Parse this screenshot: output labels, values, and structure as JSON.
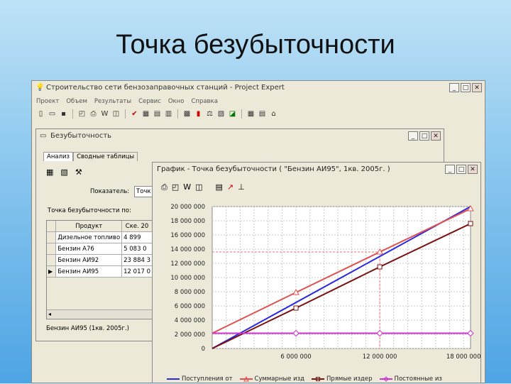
{
  "slide": {
    "title": "Точка безубыточности"
  },
  "main_window": {
    "title": "Строительство сети бензозаправочных станций - Project Expert",
    "menu": [
      "Проект",
      "Объем",
      "Результаты",
      "Сервис",
      "Окно",
      "Справка"
    ]
  },
  "be_window": {
    "title": "Безубыточность",
    "tabs": [
      "Анализ",
      "Сводные таблицы"
    ],
    "indicator_label": "Показатель:",
    "indicator_value": "Точк",
    "breakeven_label": "Точка безубыточности по:",
    "table": {
      "headers": [
        "Продукт",
        "Ске. 20"
      ],
      "rows": [
        [
          "Дизельное топливо",
          "4 899"
        ],
        [
          "Бензин А76",
          "5 083 0"
        ],
        [
          "Бензин АИ92",
          "23 884 3"
        ],
        [
          "Бензин АИ95",
          "12 017 0"
        ]
      ],
      "selected_row": 3
    },
    "status": "Бензин АИ95 (1кв. 2005г.)"
  },
  "chart_window": {
    "title": "График - Точка безубыточности ( \"Бензин АИ95\", 1кв. 2005г. )"
  },
  "chart_data": {
    "type": "line",
    "xlim": [
      0,
      18500000
    ],
    "ylim": [
      0,
      20000000
    ],
    "x_ticks": [
      {
        "v": 6000000,
        "label": "6 000 000"
      },
      {
        "v": 12000000,
        "label": "12 000 000"
      },
      {
        "v": 18000000,
        "label": "18 000 000"
      }
    ],
    "y_ticks": [
      {
        "v": 0,
        "label": "0"
      },
      {
        "v": 2000000,
        "label": "2 000 000"
      },
      {
        "v": 4000000,
        "label": "4 000 000"
      },
      {
        "v": 6000000,
        "label": "6 000 000"
      },
      {
        "v": 8000000,
        "label": "8 000 000"
      },
      {
        "v": 10000000,
        "label": "10 000 000"
      },
      {
        "v": 12000000,
        "label": "12 000 000"
      },
      {
        "v": 14000000,
        "label": "14 000 000"
      },
      {
        "v": 16000000,
        "label": "16 000 000"
      },
      {
        "v": 18000000,
        "label": "18 000 000"
      },
      {
        "v": 20000000,
        "label": "20 000 000"
      }
    ],
    "series": [
      {
        "name": "Поступления от",
        "color": "#2a2ae0",
        "marker": "none",
        "x": [
          0,
          18500000
        ],
        "y": [
          0,
          20000000
        ]
      },
      {
        "name": "Суммарные изд",
        "color": "#e05050",
        "marker": "triangle",
        "x": [
          0,
          6000000,
          12000000,
          18500000
        ],
        "y": [
          2150000,
          7900000,
          13600000,
          19700000
        ]
      },
      {
        "name": "Прямые издер",
        "color": "#7a1010",
        "marker": "square",
        "x": [
          0,
          6000000,
          12000000,
          18500000
        ],
        "y": [
          0,
          5700000,
          11500000,
          17600000
        ]
      },
      {
        "name": "Постоянные из",
        "color": "#d030d0",
        "marker": "diamond",
        "x": [
          0,
          6000000,
          12000000,
          18500000
        ],
        "y": [
          2150000,
          2150000,
          2150000,
          2150000
        ]
      }
    ],
    "breakeven": {
      "x": 12000000,
      "y": 13600000,
      "color": "#f07070"
    }
  }
}
